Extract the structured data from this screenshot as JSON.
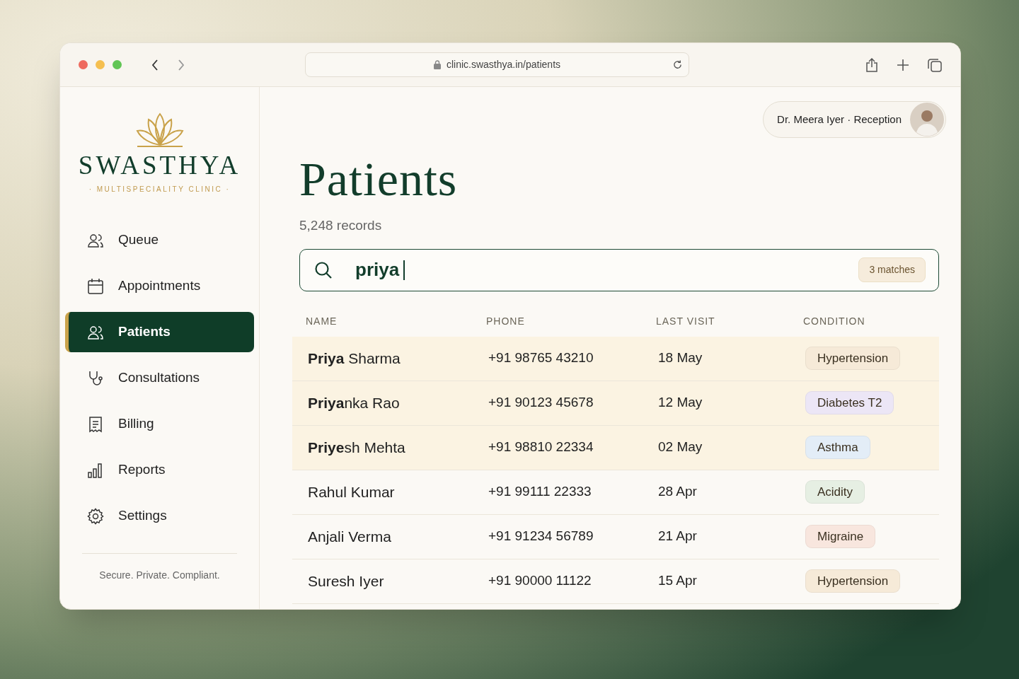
{
  "browser": {
    "url": "clinic.swasthya.in/patients"
  },
  "brand": {
    "name": "SWASTHYA",
    "tagline": "· MULTISPECIALITY CLINIC ·"
  },
  "sidebar": {
    "items": [
      {
        "label": "Queue",
        "kind": "people",
        "selected": false
      },
      {
        "label": "Appointments",
        "kind": "calendar",
        "selected": false
      },
      {
        "label": "Patients",
        "kind": "people",
        "selected": true
      },
      {
        "label": "Consultations",
        "kind": "stethoscope",
        "selected": false
      },
      {
        "label": "Billing",
        "kind": "receipt",
        "selected": false
      },
      {
        "label": "Reports",
        "kind": "chart",
        "selected": false
      },
      {
        "label": "Settings",
        "kind": "gear",
        "selected": false
      }
    ],
    "footer": "Secure. Private. Compliant."
  },
  "user": {
    "name": "Dr. Meera Iyer",
    "separator": "·",
    "role": "Reception"
  },
  "page": {
    "title": "Patients",
    "subtitle": "5,248 records"
  },
  "search": {
    "value": "priya",
    "matches": "3 matches"
  },
  "table": {
    "columns": [
      "NAME",
      "PHONE",
      "LAST VISIT",
      "CONDITION"
    ],
    "rows": [
      {
        "name": "**Priya** Sharma",
        "phone": "+91 98765 43210",
        "last_visit": "18 May",
        "condition": "Hypertension",
        "color": "#f6ead8",
        "highlighted": true
      },
      {
        "name": "**Priya**nka Rao",
        "phone": "+91 90123 45678",
        "last_visit": "12 May",
        "condition": "Diabetes T2",
        "color": "#ece6f6",
        "highlighted": true
      },
      {
        "name": "**Priye**sh Mehta",
        "phone": "+91 98810 22334",
        "last_visit": "02 May",
        "condition": "Asthma",
        "color": "#e3edf7",
        "highlighted": true
      },
      {
        "name": "Rahul Kumar",
        "phone": "+91 99111 22333",
        "last_visit": "28 Apr",
        "condition": "Acidity",
        "color": "#e6efe3",
        "highlighted": false
      },
      {
        "name": "Anjali Verma",
        "phone": "+91 91234 56789",
        "last_visit": "21 Apr",
        "condition": "Migraine",
        "color": "#f8e6de",
        "highlighted": false
      },
      {
        "name": "Suresh Iyer",
        "phone": "+91 90000 11122",
        "last_visit": "15 Apr",
        "condition": "Hypertension",
        "color": "#f6ead8",
        "highlighted": false
      }
    ]
  }
}
